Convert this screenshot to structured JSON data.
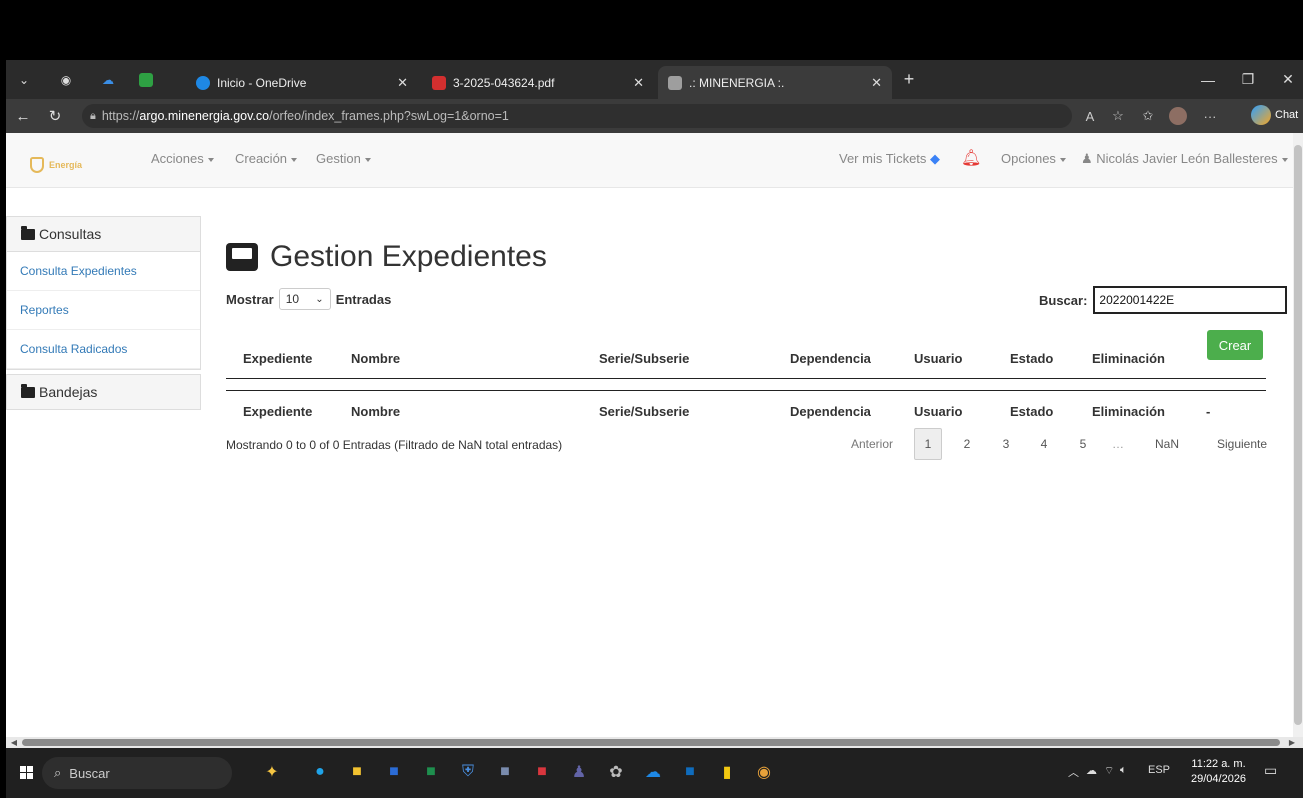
{
  "browser": {
    "tabs": [
      {
        "title": "Inicio - OneDrive",
        "color": "#1e88e5"
      },
      {
        "title": "3-2025-043624.pdf",
        "color": "#d32f2f"
      },
      {
        "title": ".: MINENERGIA :.",
        "color": "#9e9e9e"
      }
    ],
    "url_prefix": "https://",
    "url_host": "argo.minenergia.gov.co",
    "url_path": "/orfeo/index_frames.php?swLog=1&orno=1",
    "chat_label": "Chat",
    "aa_label": "A",
    "more_label": "···"
  },
  "navbar": {
    "brand": "Energía",
    "menus": [
      "Acciones",
      "Creación",
      "Gestion"
    ],
    "tickets": "Ver mis Tickets",
    "opciones": "Opciones",
    "user": "Nicolás Javier León Ballesteres"
  },
  "sidebar": {
    "consultas": "Consultas",
    "links": [
      "Consulta Expedientes",
      "Reportes",
      "Consulta Radicados"
    ],
    "bandejas": "Bandejas"
  },
  "main": {
    "title": "Gestion Expedientes",
    "mostrar": "Mostrar",
    "entries_value": "10",
    "entradas": "Entradas",
    "buscar_label": "Buscar:",
    "buscar_value": "2022001422E",
    "crear": "Crear",
    "columns": [
      "Expediente",
      "Nombre",
      "Serie/Subserie",
      "Dependencia",
      "Usuario",
      "Estado",
      "Eliminación"
    ],
    "footer_extra": "-",
    "info": "Mostrando 0 to 0 of 0 Entradas (Filtrado de NaN total entradas)",
    "pager": {
      "prev": "Anterior",
      "pages": [
        "1",
        "2",
        "3",
        "4",
        "5",
        "…",
        "NaN"
      ],
      "next": "Siguiente"
    }
  },
  "taskbar": {
    "search": "Buscar",
    "lang": "ESP",
    "time": "11:22 a. m.",
    "date": "29/04/2026"
  }
}
